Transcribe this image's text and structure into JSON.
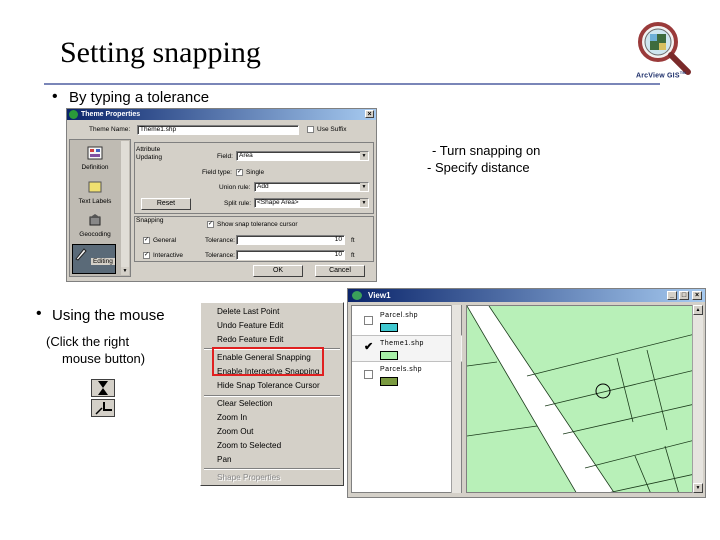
{
  "slide": {
    "title": "Setting snapping",
    "bullet1": "By typing a tolerance",
    "bullet2": "Using the mouse",
    "bullet2_sub1": "(Click the right",
    "bullet2_sub2": "mouse button)",
    "note1": "- Turn snapping on",
    "note2": "-  Specify distance",
    "bullet_char": "•"
  },
  "logo": {
    "text": "ArcView GIS",
    "tm": "TM",
    "icon": "magnifier-globe-icon"
  },
  "dialog": {
    "title": "Theme Properties",
    "close": "×",
    "theme_name_label": "Theme Name:",
    "theme_name_value": "Theme1.shp",
    "use_suffix_label": "Use Suffix",
    "sidebar": [
      {
        "label": "Definition",
        "icon": "definition-icon"
      },
      {
        "label": "Text Labels",
        "icon": "text-labels-icon"
      },
      {
        "label": "Geocoding",
        "icon": "geocoding-icon"
      },
      {
        "label": "Editing",
        "icon": "editing-icon"
      }
    ],
    "attribute_updating_label1": "Attribute",
    "attribute_updating_label2": "Updating",
    "field_label": "Field:",
    "field_value": "Area",
    "field_type_label": "Field type:",
    "single_label": "Single",
    "union_rule_label": "Union rule:",
    "union_rule_value": "Add",
    "split_rule_label": "Split rule:",
    "split_rule_value": "<Shape Area>",
    "reset_label": "Reset",
    "snapping_label": "Snapping",
    "show_cursor_label": "Show snap tolerance cursor",
    "general_label": "General",
    "interactive_label": "Interactive",
    "tolerance_label": "Tolerance:",
    "general_tolerance": "10",
    "interactive_tolerance": "10",
    "units": "ft",
    "ok_label": "OK",
    "cancel_label": "Cancel",
    "check_mark": "✓"
  },
  "context_menu": {
    "items_top": [
      "Delete Last Point",
      "Undo Feature Edit",
      "Redo Feature Edit"
    ],
    "items_snap": [
      "Enable General Snapping",
      "Enable Interactive Snapping",
      "Hide Snap Tolerance Cursor"
    ],
    "items_view": [
      "Clear Selection",
      "Zoom In",
      "Zoom Out",
      "Zoom to Selected",
      "Pan"
    ],
    "item_disabled": "Shape Properties"
  },
  "view": {
    "title": "View1",
    "minimize": "_",
    "maximize": "□",
    "close": "×",
    "legend": [
      {
        "name": "Parcel.shp",
        "checked": false,
        "color": "#40c8d0"
      },
      {
        "name": "Theme1.shp",
        "checked": true,
        "color": "#a8f0a8"
      },
      {
        "name": "Parcels.shp",
        "checked": false,
        "color": "#7a9a40"
      }
    ],
    "check_mark": "✔",
    "map_fill": "#b8f0b8"
  }
}
